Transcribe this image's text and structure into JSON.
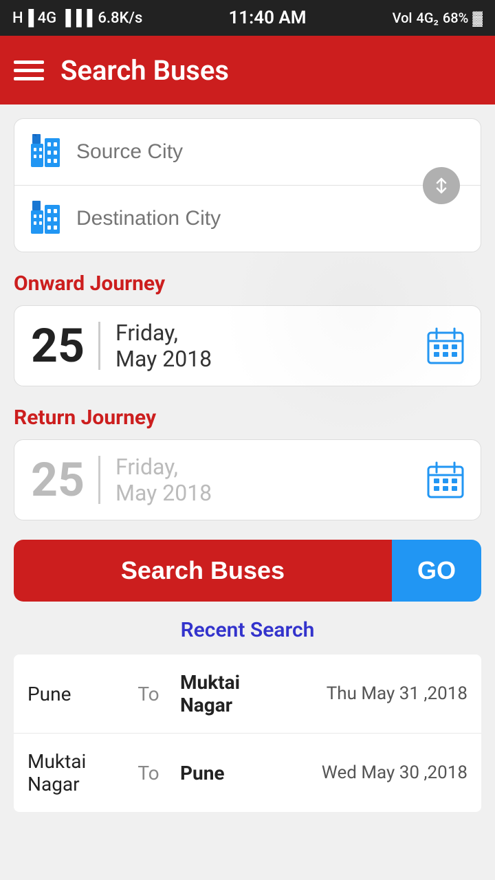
{
  "statusBar": {
    "signal": "H 4G",
    "network": "4G",
    "speed": "6.8K/s",
    "time": "11:40 AM",
    "battery": "68%",
    "volte": "VoLTE"
  },
  "header": {
    "title": "Search Buses"
  },
  "citySearch": {
    "sourcePlaceholder": "Source City",
    "destPlaceholder": "Destination City"
  },
  "onwardJourney": {
    "label": "Onward Journey",
    "dateNumber": "25",
    "dateDay": "Friday,",
    "dateMonth": "May 2018"
  },
  "returnJourney": {
    "label": "Return Journey",
    "dateNumber": "25",
    "dateDay": "Friday,",
    "dateMonth": "May 2018"
  },
  "searchButton": {
    "label": "Search Buses",
    "goLabel": "GO"
  },
  "recentSearch": {
    "title": "Recent Search",
    "items": [
      {
        "from": "Pune",
        "to": "To",
        "dest": "Muktai\nNagar",
        "date": "Thu May 31 ,2018"
      },
      {
        "from": "Muktai\nNagar",
        "to": "To",
        "dest": "Pune",
        "date": "Wed May 30 ,2018"
      }
    ]
  }
}
